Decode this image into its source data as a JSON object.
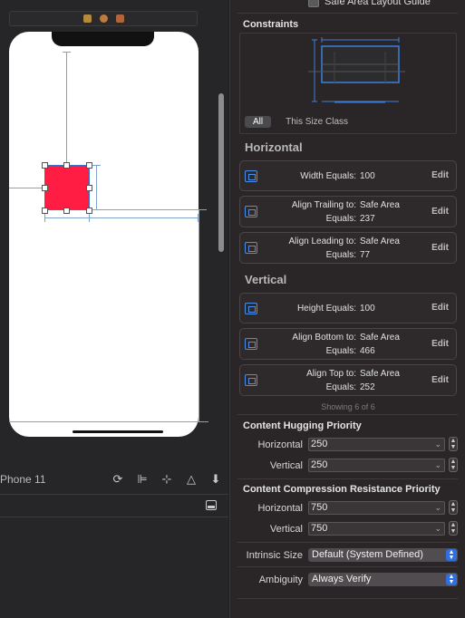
{
  "canvas": {
    "device_label": "Phone 11"
  },
  "inspector": {
    "safe_area_label": "Safe Area Layout Guide",
    "constraints_title": "Constraints",
    "tabs": {
      "all": "All",
      "size_class": "This Size Class"
    },
    "horizontal_title": "Horizontal",
    "vertical_title": "Vertical",
    "horizontal": [
      {
        "line1_label": "Width Equals:",
        "line1_value": "100",
        "line2_label": "",
        "line2_value": "",
        "edit": "Edit"
      },
      {
        "line1_label": "Align Trailing to:",
        "line1_value": "Safe Area",
        "line2_label": "Equals:",
        "line2_value": "237",
        "edit": "Edit"
      },
      {
        "line1_label": "Align Leading to:",
        "line1_value": "Safe Area",
        "line2_label": "Equals:",
        "line2_value": "77",
        "edit": "Edit"
      }
    ],
    "vertical": [
      {
        "line1_label": "Height Equals:",
        "line1_value": "100",
        "line2_label": "",
        "line2_value": "",
        "edit": "Edit"
      },
      {
        "line1_label": "Align Bottom to:",
        "line1_value": "Safe Area",
        "line2_label": "Equals:",
        "line2_value": "466",
        "edit": "Edit"
      },
      {
        "line1_label": "Align Top to:",
        "line1_value": "Safe Area",
        "line2_label": "Equals:",
        "line2_value": "252",
        "edit": "Edit"
      }
    ],
    "showing": "Showing 6 of 6",
    "hugging": {
      "title": "Content Hugging Priority",
      "horizontal_label": "Horizontal",
      "horizontal_value": "250",
      "vertical_label": "Vertical",
      "vertical_value": "250"
    },
    "compression": {
      "title": "Content Compression Resistance Priority",
      "horizontal_label": "Horizontal",
      "horizontal_value": "750",
      "vertical_label": "Vertical",
      "vertical_value": "750"
    },
    "intrinsic": {
      "label": "Intrinsic Size",
      "value": "Default (System Defined)"
    },
    "ambiguity": {
      "label": "Ambiguity",
      "value": "Always Verify"
    }
  },
  "colors": {
    "accent": "#2f6fe2",
    "view_fill": "#ff1d43",
    "guide": "#7fa3cc"
  }
}
